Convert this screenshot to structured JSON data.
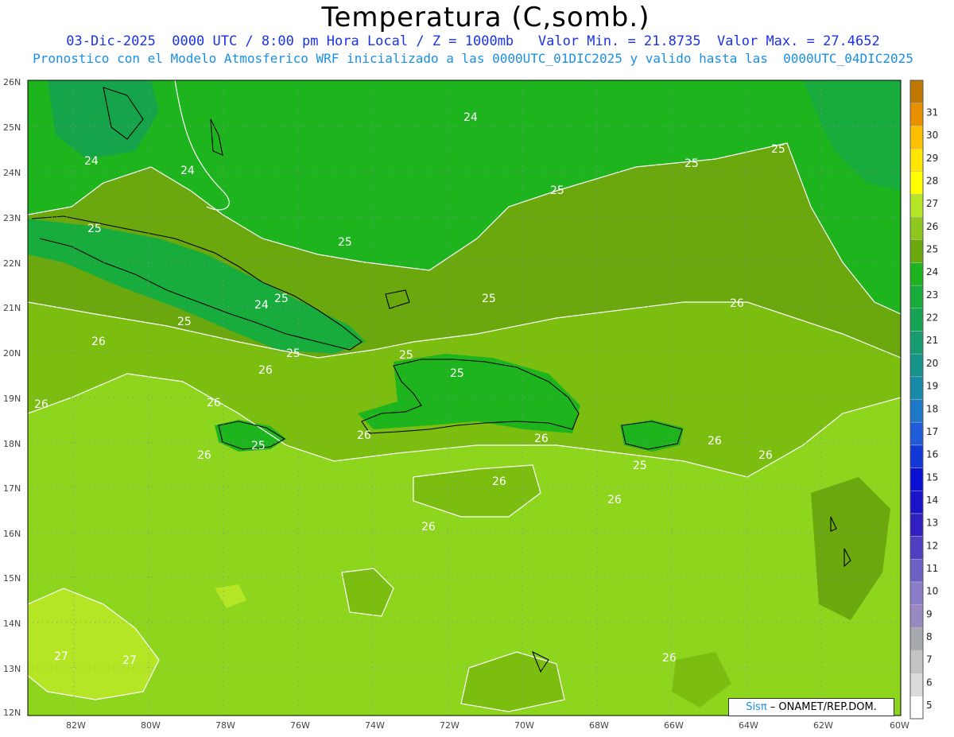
{
  "title": "Temperatura (C,somb.)",
  "subtitle_line1": "03-Dic-2025  0000 UTC / 8:00 pm Hora Local / Z = 1000mb   Valor Min. = 21.8735  Valor Max. = 27.4652",
  "subtitle_line2": "Pronostico con el Modelo Atmosferico WRF inicializado a las 0000UTC_01DIC2025 y valido hasta las  0000UTC_04DIC2025",
  "credit": {
    "brand": "Sisπ",
    "text": " – ONAMET/REP.DOM."
  },
  "lat_labels": [
    "26N",
    "25N",
    "24N",
    "23N",
    "22N",
    "21N",
    "20N",
    "19N",
    "18N",
    "17N",
    "16N",
    "15N",
    "14N",
    "13N",
    "12N"
  ],
  "lon_labels": [
    "82W",
    "80W",
    "78W",
    "76W",
    "74W",
    "72W",
    "70W",
    "68W",
    "66W",
    "64W",
    "62W",
    "60W"
  ],
  "colorbar": [
    {
      "label": "5",
      "color": "#ffffff"
    },
    {
      "label": "6",
      "color": "#dcdcdc"
    },
    {
      "label": "7",
      "color": "#c4c4c4"
    },
    {
      "label": "8",
      "color": "#a8a8b0"
    },
    {
      "label": "9",
      "color": "#9a88c0"
    },
    {
      "label": "10",
      "color": "#8a7cc8"
    },
    {
      "label": "11",
      "color": "#6c60c4"
    },
    {
      "label": "12",
      "color": "#4e40c0"
    },
    {
      "label": "13",
      "color": "#3020c0"
    },
    {
      "label": "14",
      "color": "#1a14c8"
    },
    {
      "label": "15",
      "color": "#0a10d4"
    },
    {
      "label": "16",
      "color": "#1438d8"
    },
    {
      "label": "17",
      "color": "#1e5cd8"
    },
    {
      "label": "18",
      "color": "#1e78c8"
    },
    {
      "label": "19",
      "color": "#168aa8"
    },
    {
      "label": "20",
      "color": "#16948c"
    },
    {
      "label": "21",
      "color": "#169c70"
    },
    {
      "label": "22",
      "color": "#16a454"
    },
    {
      "label": "23",
      "color": "#18ac3c"
    },
    {
      "label": "24",
      "color": "#1eb41e"
    },
    {
      "label": "25",
      "color": "#6aa80e"
    },
    {
      "label": "26",
      "color": "#8ec81e"
    },
    {
      "label": "27",
      "color": "#b4e626"
    },
    {
      "label": "28",
      "color": "#ffff00"
    },
    {
      "label": "29",
      "color": "#ffe600"
    },
    {
      "label": "30",
      "color": "#ffc000"
    },
    {
      "label": "31",
      "color": "#e89000"
    },
    {
      "label": "",
      "color": "#c07800"
    }
  ],
  "contour_labels": [
    "24",
    "24",
    "24",
    "24",
    "25",
    "25",
    "25",
    "25",
    "25",
    "25",
    "25",
    "25",
    "25",
    "25",
    "25",
    "25",
    "25",
    "26",
    "26",
    "26",
    "26",
    "26",
    "26",
    "26",
    "26",
    "26",
    "26",
    "26",
    "26",
    "26",
    "26",
    "27",
    "27"
  ]
}
